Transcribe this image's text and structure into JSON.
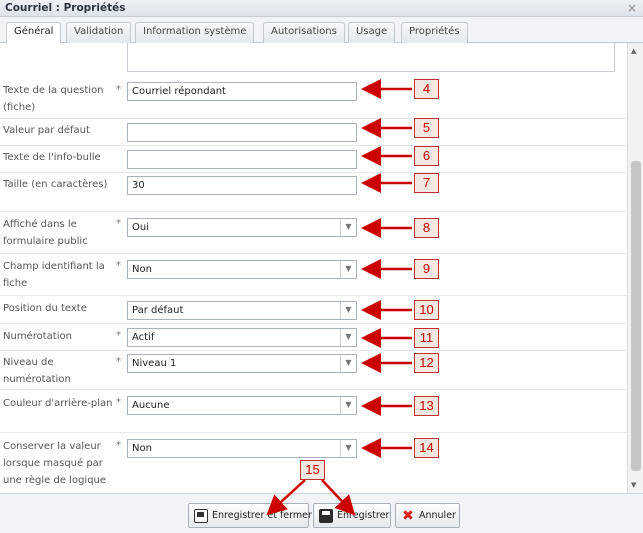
{
  "window": {
    "title": "Courriel : Propriétés",
    "close_glyph": "×"
  },
  "tabs": [
    {
      "label": "Général",
      "active": true
    },
    {
      "label": "Validation"
    },
    {
      "label": "Information système"
    },
    {
      "label": "Autorisations"
    },
    {
      "label": "Usage"
    },
    {
      "label": "Propriétés"
    }
  ],
  "form": {
    "required_marker": "*",
    "rows": [
      {
        "label": "Texte de la question (fiche)",
        "required": true,
        "type": "text",
        "value": "Courriel répondant",
        "callout": "4"
      },
      {
        "label": "Valeur par défaut",
        "required": false,
        "type": "text",
        "value": "",
        "callout": "5"
      },
      {
        "label": "Texte de l'info-bulle",
        "required": false,
        "type": "text",
        "value": "",
        "callout": "6"
      },
      {
        "label": "Taille (en caractères)",
        "required": false,
        "type": "text",
        "value": "30",
        "callout": "7"
      },
      {
        "label": "Affiché dans le formulaire public",
        "required": true,
        "type": "select",
        "value": "Oui",
        "callout": "8"
      },
      {
        "label": "Champ identifiant la fiche",
        "required": true,
        "type": "select",
        "value": "Non",
        "callout": "9"
      },
      {
        "label": "Position du texte",
        "required": false,
        "type": "select",
        "value": "Par défaut",
        "callout": "10"
      },
      {
        "label": "Numérotation",
        "required": true,
        "type": "select",
        "value": "Actif",
        "callout": "11"
      },
      {
        "label": "Niveau de numérotation",
        "required": true,
        "type": "select",
        "value": "Niveau 1",
        "callout": "12"
      },
      {
        "label": "Couleur d'arrière-plan",
        "required": true,
        "type": "select",
        "value": "Aucune",
        "callout": "13"
      },
      {
        "label": "Conserver la valeur lorsque masqué par une règle de logique",
        "required": true,
        "type": "select",
        "value": "Non",
        "callout": "14"
      }
    ]
  },
  "footer": {
    "callout": "15",
    "buttons": [
      {
        "label": "Enregistrer et fermer",
        "icon": "save-close-icon"
      },
      {
        "label": "Enregistrer",
        "icon": "save-icon"
      },
      {
        "label": "Annuler",
        "icon": "cancel-icon"
      }
    ]
  },
  "icons": {
    "select_arrow": "chevron-down-icon",
    "cancel": "✖",
    "scroll_up": "▲",
    "scroll_down": "▼"
  },
  "colors": {
    "callout_border": "#c03030",
    "callout_text": "#cc0000",
    "arrow": "#cc0000",
    "callout_fill": "#f3e7e1"
  }
}
